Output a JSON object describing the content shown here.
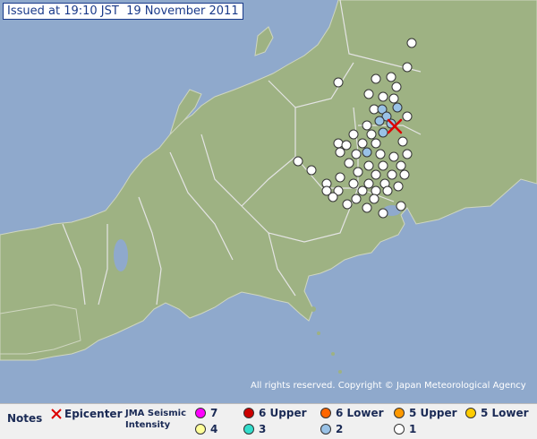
{
  "issued": "Issued at 19:10 JST  19 November 2011",
  "copyright": "All rights reserved. Copyright © Japan Meteorological Agency",
  "legend": {
    "notes": "Notes",
    "epicenter": "Epicenter",
    "intensity_line1": "JMA Seismic",
    "intensity_line2": "Intensity",
    "levels": [
      {
        "label": "7",
        "color": "#ff00ff"
      },
      {
        "label": "6 Upper",
        "color": "#cc0000"
      },
      {
        "label": "6 Lower",
        "color": "#ff6600"
      },
      {
        "label": "5 Upper",
        "color": "#ff9900"
      },
      {
        "label": "5 Lower",
        "color": "#ffcc00"
      },
      {
        "label": "4",
        "color": "#ffff99"
      },
      {
        "label": "3",
        "color": "#33ddcc"
      },
      {
        "label": "2",
        "color": "#99c2e6"
      },
      {
        "label": "1",
        "color": "#ffffff"
      }
    ]
  },
  "colors": {
    "sea": "#8fa9cc",
    "land": "#9eb283",
    "border": "#e4e4e4",
    "epicenter": "#dd0000"
  }
}
